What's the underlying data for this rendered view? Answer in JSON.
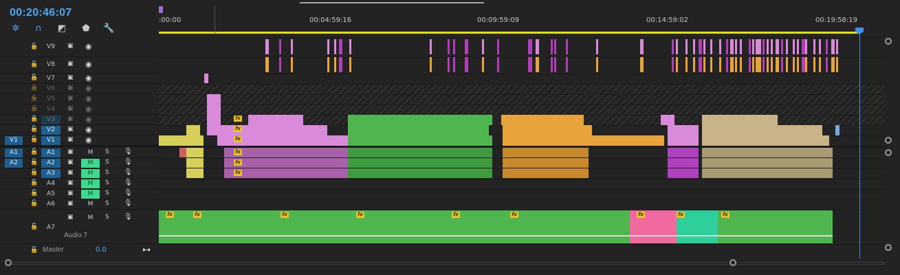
{
  "timecode": "00:20:46:07",
  "ruler": {
    "labels": [
      ":00:00",
      "00:04:59:16",
      "00:09:59:09",
      "00:14:59:02",
      "00:19:58:19"
    ]
  },
  "tools": [
    {
      "name": "snap-in-timeline-icon",
      "glyph": "✲"
    },
    {
      "name": "linked-selection-icon",
      "glyph": "∩"
    },
    {
      "name": "add-marker-edit-icon",
      "glyph": "◩"
    },
    {
      "name": "add-marker-icon",
      "glyph": "⬟"
    },
    {
      "name": "timeline-settings-icon",
      "glyph": "🔧"
    }
  ],
  "video_tracks": [
    {
      "name": "V9",
      "lock": "🔓",
      "state": "normal"
    },
    {
      "name": "V8",
      "lock": "🔓",
      "state": "normal"
    },
    {
      "name": "V7",
      "lock": "🔓",
      "state": "normal"
    },
    {
      "name": "V6",
      "lock": "🔒",
      "state": "locked"
    },
    {
      "name": "V5",
      "lock": "🔒",
      "state": "locked"
    },
    {
      "name": "V4",
      "lock": "🔒",
      "state": "locked"
    },
    {
      "name": "V3",
      "lock": "🔒",
      "state": "locked"
    },
    {
      "name": "V2",
      "lock": "🔓",
      "state": "target"
    },
    {
      "name": "V1",
      "lock": "🔓",
      "state": "target",
      "source": "V1"
    }
  ],
  "audio_tracks": [
    {
      "name": "A1",
      "source": "A1",
      "mute": "M",
      "solo": "S",
      "mute_on": false
    },
    {
      "name": "A2",
      "source": "A2",
      "mute": "M",
      "solo": "S",
      "mute_on": true
    },
    {
      "name": "A3",
      "mute": "M",
      "solo": "S",
      "mute_on": true
    },
    {
      "name": "A4",
      "mute": "M",
      "solo": "S",
      "mute_on": true
    },
    {
      "name": "A5",
      "mute": "M",
      "solo": "S",
      "mute_on": true
    },
    {
      "name": "A6",
      "mute": "M",
      "solo": "S",
      "mute_on": false
    },
    {
      "name": "A7",
      "mute": "M",
      "solo": "S",
      "mute_on": false,
      "label": "Audio 7"
    }
  ],
  "master": {
    "label": "Master",
    "value": "0.0"
  },
  "fx_label": "fx",
  "colors": {
    "accent": "#4ea6f7",
    "work_area": "#e8e000",
    "mute_on": "#3ed98e",
    "clip_magenta": "#b13fb8",
    "clip_orange": "#e8a33a",
    "clip_pink": "#d98ad9",
    "clip_green": "#4fb54f",
    "clip_tan": "#c9b48a",
    "clip_yellow": "#d6d05a",
    "clip_hotpink": "#f06aa0",
    "clip_teal": "#2ecf9a"
  }
}
